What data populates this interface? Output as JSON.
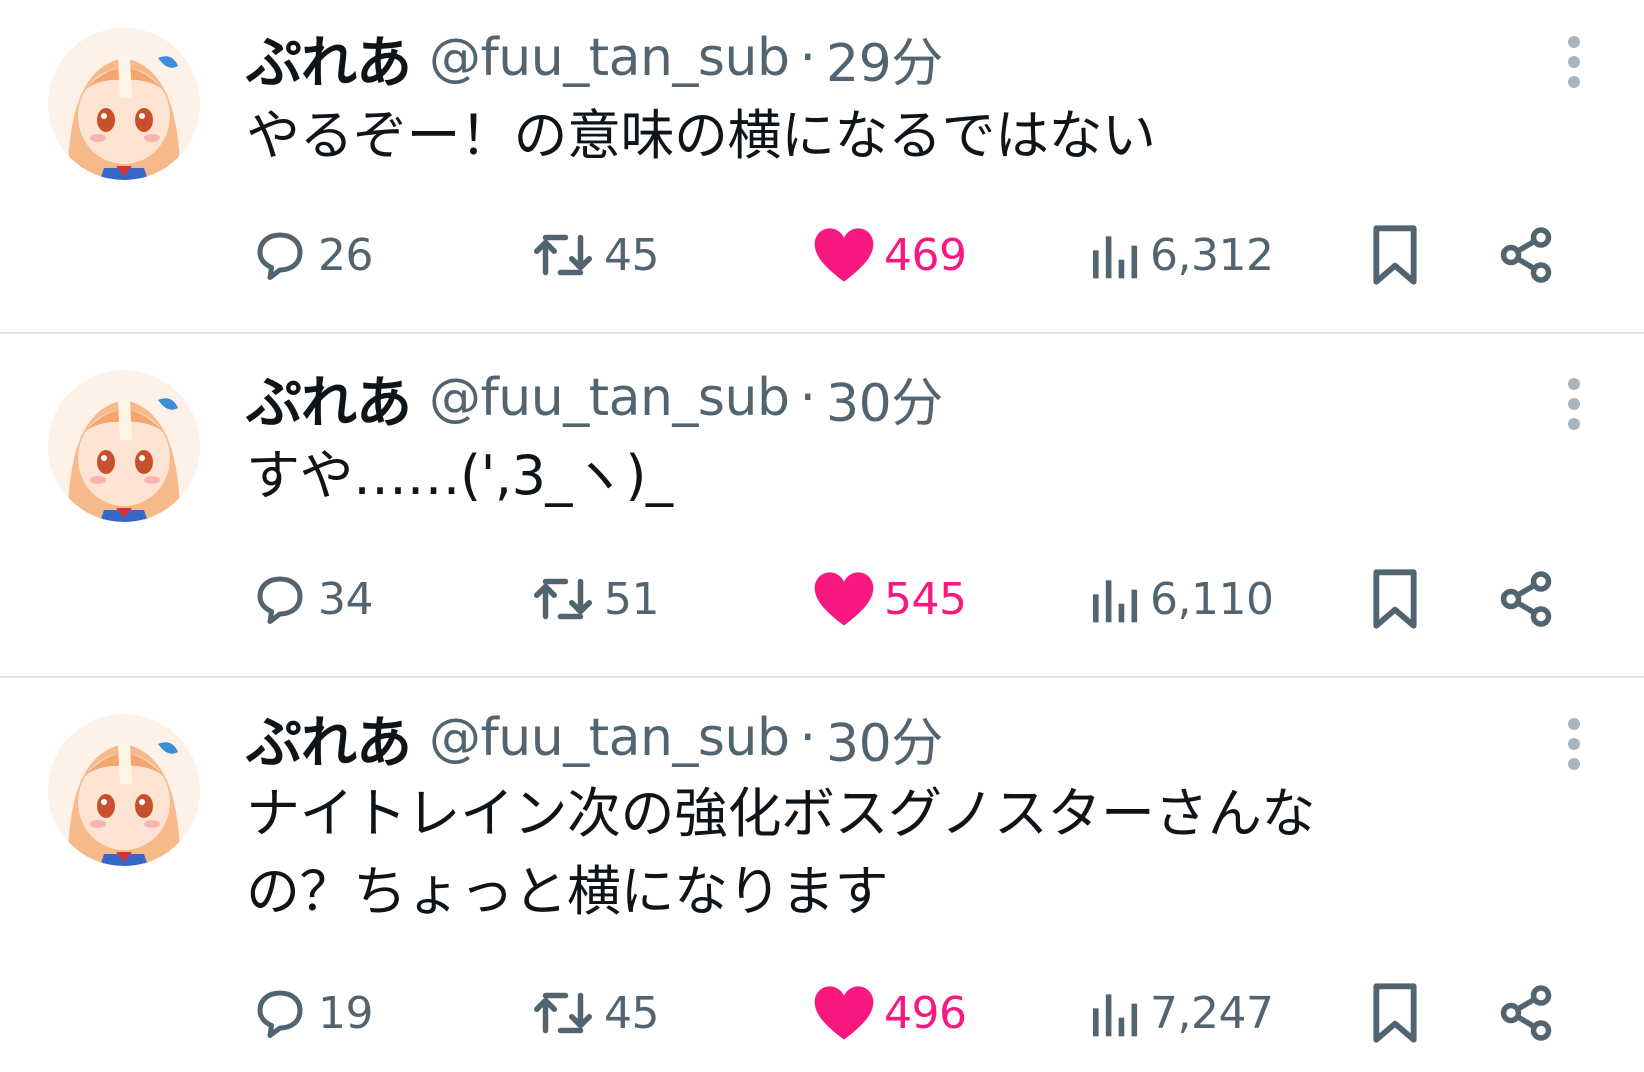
{
  "tweets": [
    {
      "name": "ぷれあ",
      "handle": "@fuu_tan_sub",
      "separator": "·",
      "time": "29分",
      "text_lines": [
        "やるぞー！の意味の横になるではない"
      ],
      "replies": "26",
      "reposts": "45",
      "likes": "469",
      "views": "6,312"
    },
    {
      "name": "ぷれあ",
      "handle": "@fuu_tan_sub",
      "separator": "·",
      "time": "30分",
      "text_lines": [
        "すや……(',3_ヽ)_"
      ],
      "replies": "34",
      "reposts": "51",
      "likes": "545",
      "views": "6,110"
    },
    {
      "name": "ぷれあ",
      "handle": "@fuu_tan_sub",
      "separator": "·",
      "time": "30分",
      "text_lines": [
        "ナイトレイン次の強化ボスグノスターさんな",
        "の？ちょっと横になります"
      ],
      "replies": "19",
      "reposts": "45",
      "likes": "496",
      "views": "7,247"
    }
  ],
  "icons": {
    "reply": "reply-icon",
    "repost": "repost-icon",
    "like": "heart-icon",
    "views": "views-chart-icon",
    "bookmark": "bookmark-icon",
    "share": "share-icon",
    "more": "more-vertical-icon"
  },
  "colors": {
    "like_accent": "#f91880",
    "secondary_text": "#536471",
    "divider": "#e3e6ea"
  }
}
